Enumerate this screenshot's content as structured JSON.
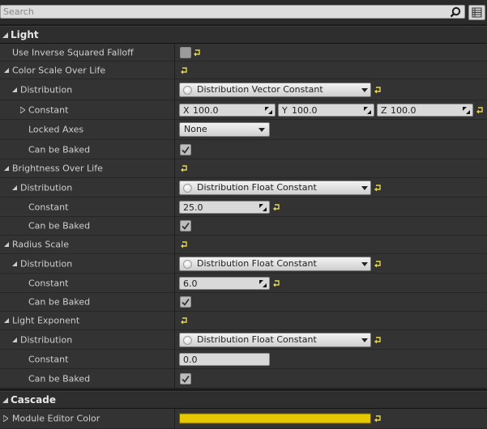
{
  "search": {
    "placeholder": "Search"
  },
  "colors": {
    "reset_arrow": "#e8d84a",
    "module_editor_color": "#e6c800"
  },
  "light": {
    "title": "Light",
    "use_inverse_squared_falloff": {
      "label": "Use Inverse Squared Falloff",
      "checked": false
    },
    "color_scale_over_life": {
      "label": "Color Scale Over Life",
      "distribution": {
        "label": "Distribution",
        "value": "Distribution Vector Constant"
      },
      "constant": {
        "label": "Constant",
        "x_label": "X",
        "x": "100.0",
        "y_label": "Y",
        "y": "100.0",
        "z_label": "Z",
        "z": "100.0"
      },
      "locked_axes": {
        "label": "Locked Axes",
        "value": "None"
      },
      "can_be_baked": {
        "label": "Can be Baked",
        "checked": true
      }
    },
    "brightness_over_life": {
      "label": "Brightness Over Life",
      "distribution": {
        "label": "Distribution",
        "value": "Distribution Float Constant"
      },
      "constant": {
        "label": "Constant",
        "value": "25.0"
      },
      "can_be_baked": {
        "label": "Can be Baked",
        "checked": true
      }
    },
    "radius_scale": {
      "label": "Radius Scale",
      "distribution": {
        "label": "Distribution",
        "value": "Distribution Float Constant"
      },
      "constant": {
        "label": "Constant",
        "value": "6.0"
      },
      "can_be_baked": {
        "label": "Can be Baked",
        "checked": true
      }
    },
    "light_exponent": {
      "label": "Light Exponent",
      "distribution": {
        "label": "Distribution",
        "value": "Distribution Float Constant"
      },
      "constant": {
        "label": "Constant",
        "value": "0.0"
      },
      "can_be_baked": {
        "label": "Can be Baked",
        "checked": true
      }
    }
  },
  "cascade": {
    "title": "Cascade",
    "module_editor_color": {
      "label": "Module Editor Color"
    }
  },
  "icons": {
    "search": "magnifier-icon",
    "view_options": "grid-icon",
    "reset": "reset-arrow-icon",
    "expand": "triangle-icon",
    "dropdown": "chevron-down-icon",
    "drag": "drag-handle-icon",
    "check": "checkmark-icon"
  }
}
